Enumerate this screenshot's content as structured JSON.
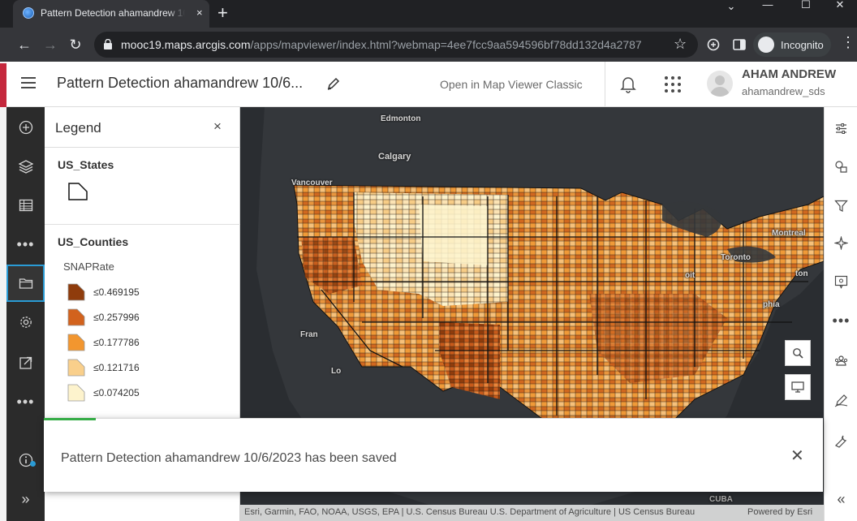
{
  "browser": {
    "tab_title": "Pattern Detection ahamandrew 10/6/2023",
    "tab_close": "×",
    "new_tab": "+",
    "window_controls": [
      "⌄",
      "—",
      "☐",
      "✕"
    ],
    "url_host": "mooc19.maps.arcgis.com",
    "url_path": "/apps/mapviewer/index.html?webmap=4ee7fcc9aa594596bf78dd132d4a2787",
    "incognito_label": "Incognito",
    "menu": "⋮"
  },
  "header": {
    "title": "Pattern Detection ahamandrew 10/6...",
    "classic_link": "Open in Map Viewer Classic",
    "user_name": "AHAM ANDREW",
    "user_id": "ahamandrew_sds"
  },
  "legend": {
    "title": "Legend",
    "close": "×",
    "layers": [
      {
        "name": "US_States"
      },
      {
        "name": "US_Counties",
        "field": "SNAPRate",
        "classes": [
          {
            "label": "≤0.469195",
            "color": "#8f3c0c"
          },
          {
            "label": "≤0.257996",
            "color": "#d2621d"
          },
          {
            "label": "≤0.177786",
            "color": "#f2962f"
          },
          {
            "label": "≤0.121716",
            "color": "#f9cf8b"
          },
          {
            "label": "≤0.074205",
            "color": "#fdf3cd"
          }
        ]
      }
    ]
  },
  "map": {
    "places": [
      "Edmonton",
      "Calgary",
      "Vancouver",
      "Montreal",
      "Toronto",
      "oit",
      "ton",
      "phia",
      "Fran",
      "Lo",
      "CUBA"
    ],
    "attribution": "Esri, Garmin, FAO, NOAA, USGS, EPA | U.S. Census Bureau U.S. Department of Agriculture | US Census Bureau",
    "powered_by": "Powered by Esri"
  },
  "toast": {
    "message": "Pattern Detection ahamandrew 10/6/2023 has been saved",
    "close": "✕"
  },
  "nav": {
    "expand": "»",
    "collapse": "«"
  },
  "colors": {
    "accent": "#2a9bd5",
    "success": "#35ac46",
    "action_bar": "#2b2b2b"
  }
}
